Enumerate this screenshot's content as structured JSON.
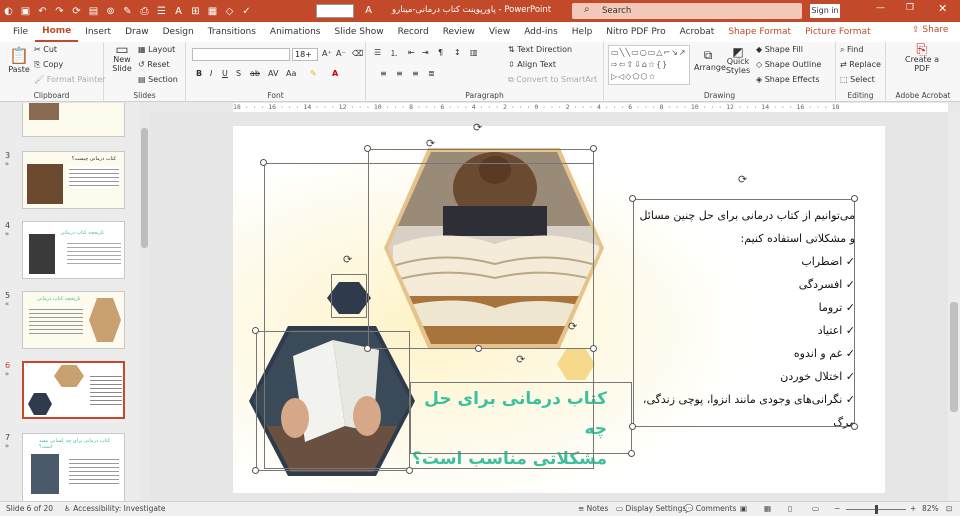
{
  "app": {
    "title": "پاورپوینت کتاب درمانی-مینارو - PowerPoint",
    "search_placeholder": "Search",
    "signin": "Sign in",
    "font_size": "18+"
  },
  "tabs": [
    "File",
    "Home",
    "Insert",
    "Draw",
    "Design",
    "Transitions",
    "Animations",
    "Slide Show",
    "Record",
    "Review",
    "View",
    "Add-ins",
    "Help",
    "Nitro PDF Pro",
    "Acrobat",
    "Shape Format",
    "Picture Format"
  ],
  "share": "Share",
  "ribbon": {
    "clipboard": {
      "paste": "Paste",
      "cut": "Cut",
      "copy": "Copy",
      "format_painter": "Format Painter",
      "label": "Clipboard"
    },
    "slides": {
      "new_slide": "New Slide",
      "layout": "Layout",
      "reset": "Reset",
      "section": "Section",
      "label": "Slides"
    },
    "font": {
      "label": "Font"
    },
    "paragraph": {
      "text_direction": "Text Direction",
      "align_text": "Align Text",
      "smartart": "Convert to SmartArt",
      "label": "Paragraph"
    },
    "drawing": {
      "arrange": "Arrange",
      "quick_styles": "Quick Styles",
      "shape_fill": "Shape Fill",
      "shape_outline": "Shape Outline",
      "shape_effects": "Shape Effects",
      "label": "Drawing"
    },
    "editing": {
      "find": "Find",
      "replace": "Replace",
      "select": "Select",
      "label": "Editing"
    },
    "acrobat": {
      "create_pdf": "Create a PDF",
      "label": "Adobe Acrobat"
    }
  },
  "ruler_text": "18 · · · 16 · · · 14 · · · 12 · · · 10 · · · 8 · · · 6 · · · 4 · · · 2 · · · 0 · · · 2 · · · 4 · · · 6 · · · 8 · · · 10 · · · 12 · · · 14 · · · 16 · · · 18",
  "thumbnails": [
    {
      "num": "3",
      "title": "کتاب درمانی چیست؟"
    },
    {
      "num": "4",
      "title": "تاریخچه کتاب درمانی"
    },
    {
      "num": "5",
      "title": "تاریخچه کتاب درمانی"
    },
    {
      "num": "6",
      "title": ""
    },
    {
      "num": "7",
      "title": "کتاب درمانی برای چه کسانی مفید است؟"
    }
  ],
  "slide": {
    "heading_line1": "کتاب درمانی برای حل چه",
    "heading_line2": "مشکلاتی مناسب است؟",
    "intro": "می‌توانیم از کتاب درمانی برای حل چنین مسائل و مشکلاتی استفاده کنیم:",
    "bullets": [
      "اضطراب",
      "افسردگی",
      "تروما",
      "اعتیاد",
      "غم و اندوه",
      "اختلال خوردن",
      "نگرانی‌های وجودی مانند انزوا، پوچی زندگی، مرگ"
    ],
    "colors": {
      "accent": "#3cc0a0",
      "hex_border": "#e6c38a",
      "dark_hex": "#2f3b4a"
    }
  },
  "status": {
    "slide_of": "Slide 6 of 20",
    "accessibility": "Accessibility: Investigate",
    "notes": "Notes",
    "display": "Display Settings",
    "comments": "Comments",
    "zoom": "82%"
  }
}
